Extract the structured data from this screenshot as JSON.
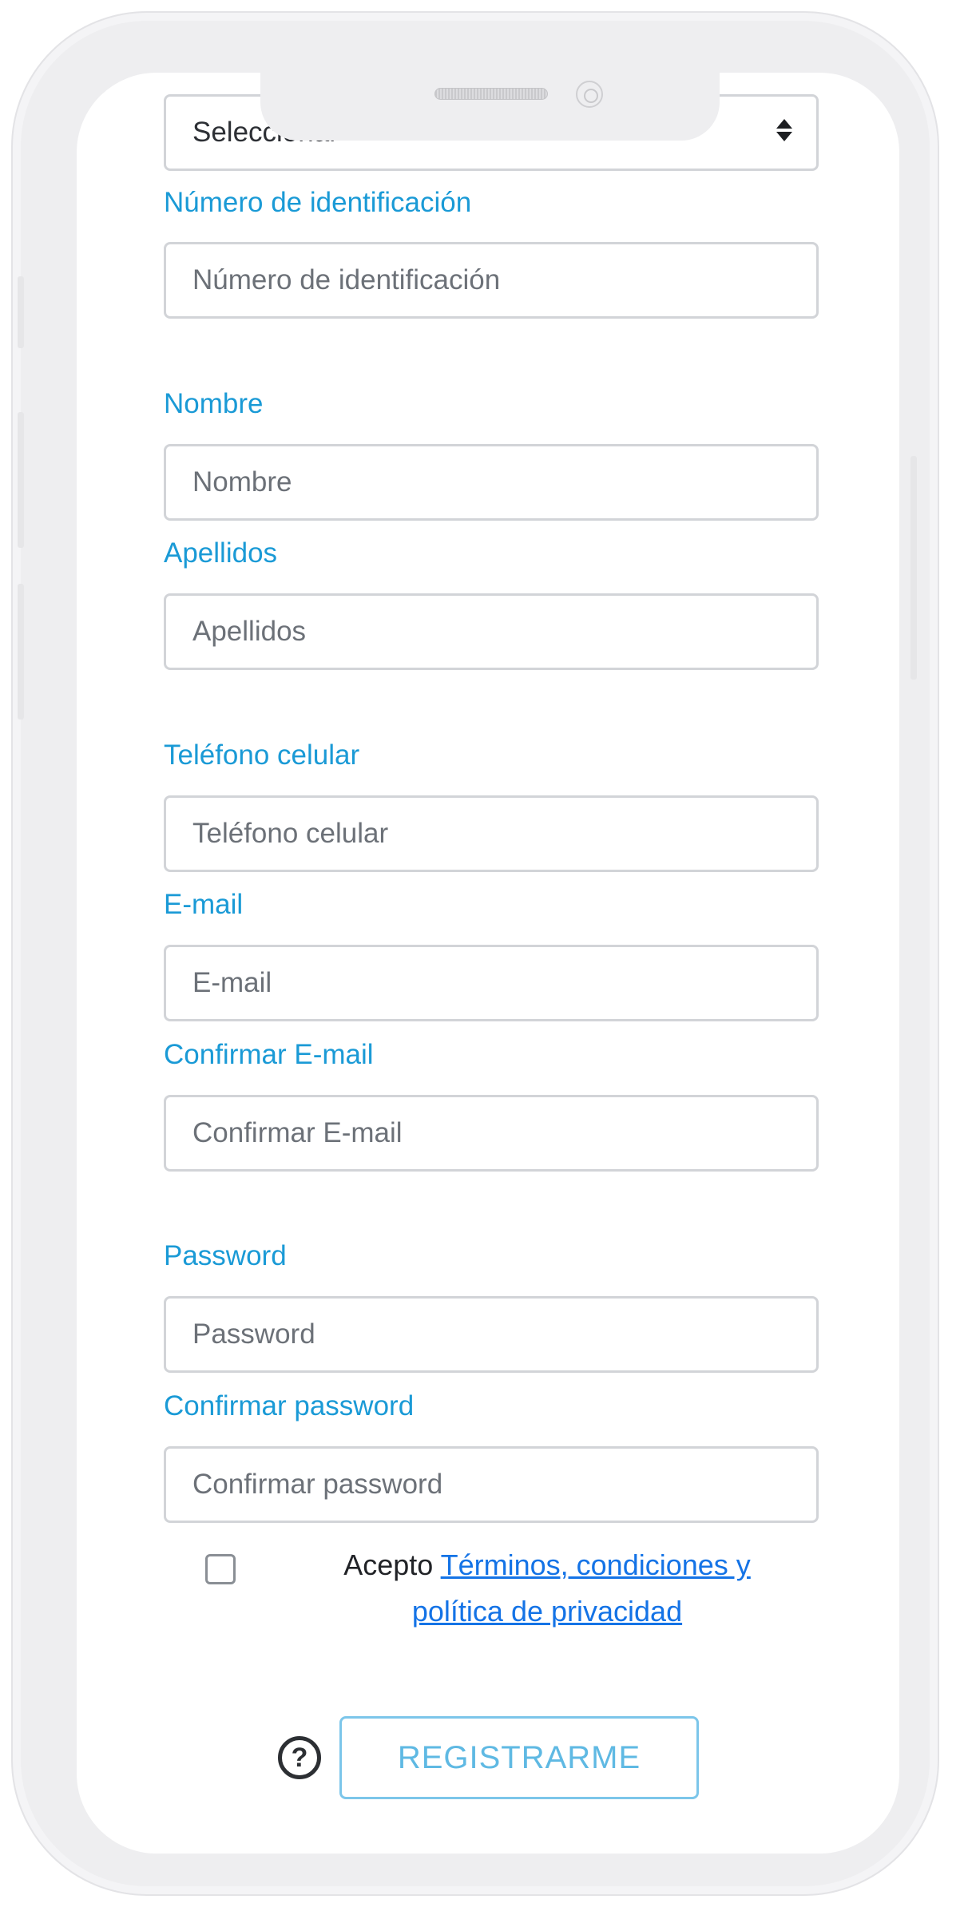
{
  "form": {
    "id_type": {
      "value": "Seleccionar"
    },
    "id_number": {
      "label": "Número de identificación",
      "placeholder": "Número de identificación"
    },
    "first_name": {
      "label": "Nombre",
      "placeholder": "Nombre"
    },
    "last_name": {
      "label": "Apellidos",
      "placeholder": "Apellidos"
    },
    "phone": {
      "label": "Teléfono celular",
      "placeholder": "Teléfono celular"
    },
    "email": {
      "label": "E-mail",
      "placeholder": "E-mail"
    },
    "email_confirm": {
      "label": "Confirmar E-mail",
      "placeholder": "Confirmar E-mail"
    },
    "password": {
      "label": "Password",
      "placeholder": "Password"
    },
    "password_confirm": {
      "label": "Confirmar password",
      "placeholder": "Confirmar password"
    }
  },
  "terms": {
    "prefix": "Acepto",
    "link_line1": "Términos, condiciones y",
    "link_line2": "política de privacidad",
    "checked": false
  },
  "actions": {
    "help_icon": "?",
    "submit_label": "REGISTRARME"
  },
  "colors": {
    "label": "#1a9ad6",
    "link": "#1473e6",
    "submit_border": "#7cc6ea"
  }
}
